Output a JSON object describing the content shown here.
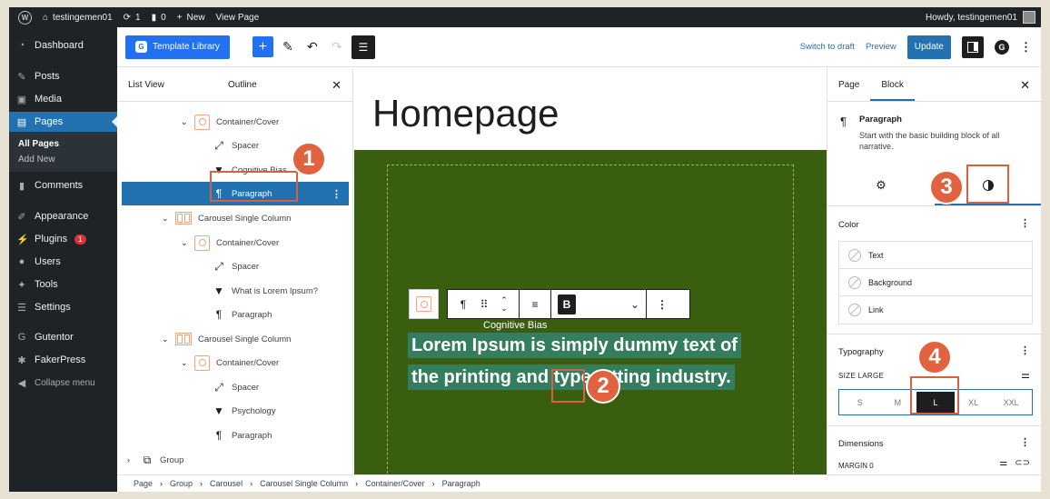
{
  "admin_bar": {
    "site_name": "testingemen01",
    "updates_count": "1",
    "comments_count": "0",
    "new_label": "New",
    "view_page_label": "View Page",
    "howdy_text": "Howdy, testingemen01"
  },
  "sidebar": {
    "items": [
      {
        "label": "Dashboard",
        "icon": "dashboard-icon"
      },
      {
        "label": "Posts",
        "icon": "pin-icon"
      },
      {
        "label": "Media",
        "icon": "media-icon"
      },
      {
        "label": "Pages",
        "icon": "pages-icon"
      },
      {
        "label": "Comments",
        "icon": "comment-icon"
      },
      {
        "label": "Appearance",
        "icon": "brush-icon"
      },
      {
        "label": "Plugins",
        "icon": "plug-icon",
        "badge": "1"
      },
      {
        "label": "Users",
        "icon": "user-icon"
      },
      {
        "label": "Tools",
        "icon": "wrench-icon"
      },
      {
        "label": "Settings",
        "icon": "sliders-icon"
      },
      {
        "label": "Gutentor",
        "icon": "gutentor-icon"
      },
      {
        "label": "FakerPress",
        "icon": "faker-icon"
      }
    ],
    "pages_submenu": [
      "All Pages",
      "Add New"
    ],
    "collapse_label": "Collapse menu"
  },
  "toolbar": {
    "template_library_label": "Template Library",
    "switch_to_draft_label": "Switch to draft",
    "preview_label": "Preview",
    "update_label": "Update"
  },
  "list_view": {
    "tabs": [
      "List View",
      "Outline"
    ],
    "rows": [
      {
        "label": "Container/Cover",
        "icon": "cover-icon"
      },
      {
        "label": "Spacer",
        "icon": "spacer-icon"
      },
      {
        "label": "Cognitive Bias",
        "icon": "heading-icon"
      },
      {
        "label": "Paragraph",
        "icon": "paragraph-icon",
        "selected": true
      },
      {
        "label": "Carousel Single Column",
        "icon": "carousel-icon"
      },
      {
        "label": "Container/Cover",
        "icon": "cover-icon"
      },
      {
        "label": "Spacer",
        "icon": "spacer-icon"
      },
      {
        "label": "What is Lorem Ipsum?",
        "icon": "heading-icon"
      },
      {
        "label": "Paragraph",
        "icon": "paragraph-icon"
      },
      {
        "label": "Carousel Single Column",
        "icon": "carousel-icon"
      },
      {
        "label": "Container/Cover",
        "icon": "cover-icon"
      },
      {
        "label": "Spacer",
        "icon": "spacer-icon"
      },
      {
        "label": "Psychology",
        "icon": "heading-icon"
      },
      {
        "label": "Paragraph",
        "icon": "paragraph-icon"
      },
      {
        "label": "Group",
        "icon": "group-icon"
      }
    ]
  },
  "canvas": {
    "page_title": "Homepage",
    "cover_heading": "Cognitive Bias",
    "paragraph_lines": [
      "Lorem Ipsum is simply dummy text of",
      "the printing and typesetting industry."
    ],
    "cover_color": "#3a5e10"
  },
  "breadcrumb": [
    "Page",
    "Group",
    "Carousel",
    "Carousel Single Column",
    "Container/Cover",
    "Paragraph"
  ],
  "inspector": {
    "tabs": [
      "Page",
      "Block"
    ],
    "block_name": "Paragraph",
    "block_description": "Start with the basic building block of all narrative.",
    "color_title": "Color",
    "color_items": [
      "Text",
      "Background",
      "Link"
    ],
    "typography_title": "Typography",
    "size_label": "SIZE LARGE",
    "sizes": [
      "S",
      "M",
      "L",
      "XL",
      "XXL"
    ],
    "selected_size": "L",
    "dimensions_title": "Dimensions",
    "margin_label": "MARGIN 0"
  },
  "callouts": [
    "1",
    "2",
    "3",
    "4"
  ],
  "colors": {
    "accent": "#2271b1",
    "callout": "#e0623e"
  }
}
